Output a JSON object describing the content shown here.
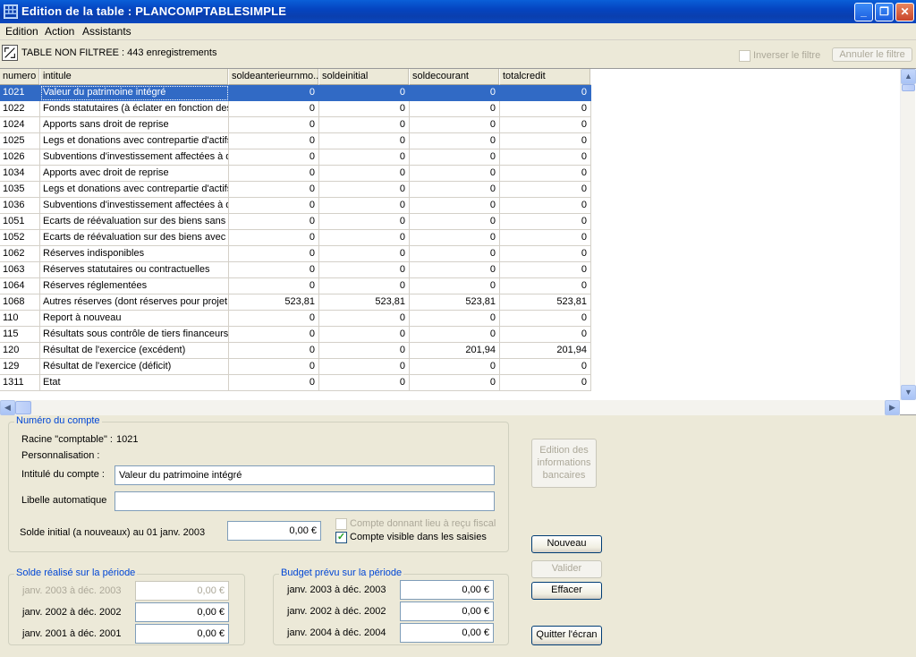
{
  "window": {
    "title": "Edition de la table : PLANCOMPTABLESIMPLE",
    "minimize_glyph": "_",
    "restore_glyph": "❐",
    "close_glyph": "✕"
  },
  "menu": [
    "Edition",
    "Action",
    "Assistants"
  ],
  "filterbar": {
    "status": "TABLE NON FILTREE : 443 enregistrements",
    "invert_label": "Inverser le filtre",
    "cancel_label": "Annuler le filtre"
  },
  "grid": {
    "columns": [
      "numero",
      "intitule",
      "soldeanterieurnmo...",
      "soldeinitial",
      "soldecourant",
      "totalcredit"
    ],
    "rows": [
      [
        "1021",
        "Valeur du patrimoine intégré",
        "0",
        "0",
        "0",
        "0"
      ],
      [
        "1022",
        "Fonds statutaires (à éclater en fonction des",
        "0",
        "0",
        "0",
        "0"
      ],
      [
        "1024",
        "Apports sans droit de reprise",
        "0",
        "0",
        "0",
        "0"
      ],
      [
        "1025",
        "Legs et donations avec contrepartie d'actifs",
        "0",
        "0",
        "0",
        "0"
      ],
      [
        "1026",
        "Subventions d'investissement affectées à d",
        "0",
        "0",
        "0",
        "0"
      ],
      [
        "1034",
        "Apports avec droit de reprise",
        "0",
        "0",
        "0",
        "0"
      ],
      [
        "1035",
        "Legs et donations avec contrepartie d'actifs",
        "0",
        "0",
        "0",
        "0"
      ],
      [
        "1036",
        "Subventions d'investissement affectées à d",
        "0",
        "0",
        "0",
        "0"
      ],
      [
        "1051",
        "Ecarts de réévaluation sur des biens sans d",
        "0",
        "0",
        "0",
        "0"
      ],
      [
        "1052",
        "Ecarts de réévaluation sur des biens avec d",
        "0",
        "0",
        "0",
        "0"
      ],
      [
        "1062",
        "Réserves indisponibles",
        "0",
        "0",
        "0",
        "0"
      ],
      [
        "1063",
        "Réserves statutaires ou contractuelles",
        "0",
        "0",
        "0",
        "0"
      ],
      [
        "1064",
        "Réserves réglementées",
        "0",
        "0",
        "0",
        "0"
      ],
      [
        "1068",
        "Autres réserves (dont réserves pour projet",
        "523,81",
        "523,81",
        "523,81",
        "523,81"
      ],
      [
        "110",
        "Report à nouveau",
        "0",
        "0",
        "0",
        "0"
      ],
      [
        "115",
        "Résultats sous contrôle de tiers financeurs",
        "0",
        "0",
        "0",
        "0"
      ],
      [
        "120",
        "Résultat de l'exercice (excédent)",
        "0",
        "0",
        "201,94",
        "201,94"
      ],
      [
        "129",
        "Résultat de l'exercice (déficit)",
        "0",
        "0",
        "0",
        "0"
      ],
      [
        "1311",
        "Etat",
        "0",
        "0",
        "0",
        "0"
      ]
    ],
    "selected_row": 0
  },
  "compte": {
    "legend": "Numéro du compte",
    "racine_label": "Racine \"comptable\" :",
    "racine_value": "1021",
    "perso_label": "Personnalisation :",
    "intitule_label": "Intitulé du compte :",
    "intitule_value": "Valeur du patrimoine intégré",
    "libelle_label": "Libelle automatique",
    "libelle_value": "",
    "solde_label": "Solde initial (a nouveaux) au 01 janv. 2003",
    "solde_value": "0,00 €",
    "recu_fiscal_label": "Compte donnant lieu à reçu fiscal",
    "visible_label": "Compte visible dans les saisies"
  },
  "solde_realise": {
    "legend": "Solde réalisé sur la période",
    "rows": [
      {
        "label": "janv. 2003 à déc. 2003",
        "value": "0,00 €"
      },
      {
        "label": "janv. 2002 à déc. 2002",
        "value": "0,00 €"
      },
      {
        "label": "janv. 2001 à déc. 2001",
        "value": "0,00 €"
      }
    ]
  },
  "budget": {
    "legend": "Budget prévu sur la période",
    "rows": [
      {
        "label": "janv. 2003 à déc. 2003",
        "value": "0,00 €"
      },
      {
        "label": "janv. 2002 à déc. 2002",
        "value": "0,00 €"
      },
      {
        "label": "janv. 2004 à déc. 2004",
        "value": "0,00 €"
      }
    ]
  },
  "actions": {
    "bank_info": "Edition des informations bancaires",
    "nouveau": "Nouveau",
    "valider": "Valider",
    "effacer": "Effacer",
    "quitter": "Quitter l'écran"
  },
  "colors": {
    "selection": "#316ac5",
    "legend_text": "#0046d5",
    "title_bar": "#0a47c0"
  }
}
